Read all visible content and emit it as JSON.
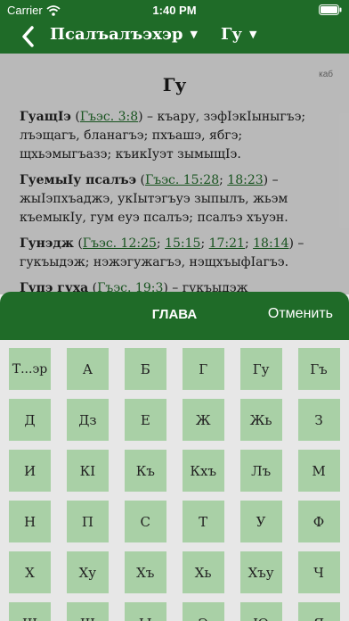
{
  "status": {
    "carrier": "Carrier",
    "time": "1:40 PM"
  },
  "nav": {
    "book": "Псалъалъэхэр",
    "chapter": "Гу"
  },
  "content": {
    "source": "каб",
    "heading": "Гу",
    "entries": [
      {
        "head": "ГуащIэ",
        "open": " (",
        "refs": [
          "Гъэс. 3:8"
        ],
        "close": ") – ",
        "text": "къару, зэфIэкIыныгъэ; лъэщагъ, бланагъэ; пхъашэ, ябгэ; щхьэмыгъазэ; къикIуэт зымыщIэ."
      },
      {
        "head": "ГуемыIу псалъэ",
        "open": " (",
        "refs": [
          "Гъэс. 15:28",
          "18:23"
        ],
        "close": ") – ",
        "text": "жыIэпхъаджэ, укIытэгъуэ зыпылъ, жьэм къемыкIу, гум еуэ псалъэ; псалъэ хъуэн."
      },
      {
        "head": "Гунэдж",
        "open": " (",
        "refs": [
          "Гъэс. 12:25",
          "15:15",
          "17:21",
          "18:14"
        ],
        "close": ") – ",
        "text": "гукъыдэж; нэжэгужагъэ, нэщхъыфIагъэ."
      },
      {
        "head": "Гупэ гуха",
        "open": " (",
        "refs": [
          "Гъэс. 19:3"
        ],
        "close": ") – ",
        "text": "гукъыдэж"
      }
    ]
  },
  "sheet": {
    "title": "ГЛАВА",
    "cancel": "Отменить"
  },
  "letters": [
    "Т...эр",
    "А",
    "Б",
    "Г",
    "Гу",
    "Гъ",
    "Д",
    "Дз",
    "Е",
    "Ж",
    "Жь",
    "З",
    "И",
    "КI",
    "Къ",
    "Кхъ",
    "Лъ",
    "М",
    "Н",
    "П",
    "С",
    "Т",
    "У",
    "Ф",
    "Х",
    "Ху",
    "Хъ",
    "Хь",
    "Хъу",
    "Ч",
    "Ш",
    "Щ",
    "Ы",
    "Э",
    "Ю",
    "Я"
  ],
  "colors": {
    "accent": "#1f6b28",
    "key": "#a9d0a6",
    "grid_bg": "#e7e7e7"
  }
}
